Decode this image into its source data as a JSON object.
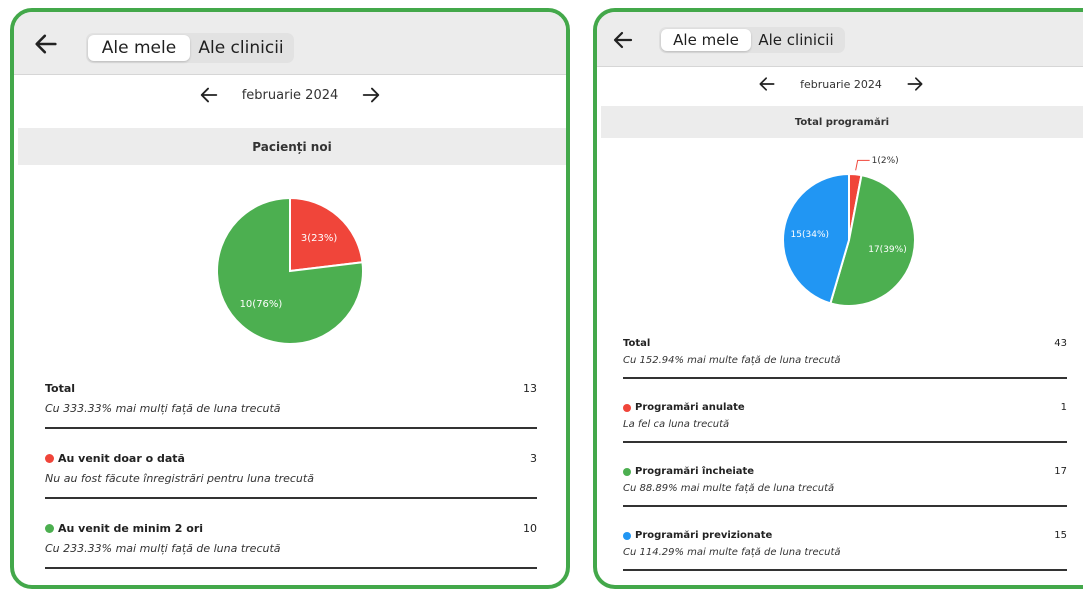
{
  "colors": {
    "frame": "#43a84a",
    "red": "#f0453a",
    "green": "#4caf50",
    "blue": "#2196f3",
    "header_bg": "#ececec"
  },
  "left": {
    "tabs": [
      "Ale mele",
      "Ale clinicii"
    ],
    "active_tab": "Ale mele",
    "month": "februarie 2024",
    "section_title": "Pacienți noi",
    "chart_data": {
      "type": "pie",
      "slices": [
        {
          "label": "3(23%)",
          "value": 3,
          "color": "#f0453a"
        },
        {
          "label": "10(76%)",
          "value": 10,
          "color": "#4caf50"
        }
      ]
    },
    "stats": [
      {
        "title": "Total",
        "value": "13",
        "subtitle": "Cu 333.33% mai mulți față de luna trecută",
        "dot": ""
      },
      {
        "title": "Au venit doar o dată",
        "value": "3",
        "subtitle": "Nu au fost făcute înregistrări pentru luna trecută",
        "dot": "#f0453a"
      },
      {
        "title": "Au venit de minim 2 ori",
        "value": "10",
        "subtitle": "Cu 233.33% mai mulți față de luna trecută",
        "dot": "#4caf50"
      }
    ]
  },
  "right": {
    "tabs": [
      "Ale mele",
      "Ale clinicii"
    ],
    "active_tab": "Ale mele",
    "month": "februarie 2024",
    "section_title": "Total programări",
    "chart_data": {
      "type": "pie",
      "slices": [
        {
          "label": "1(2%)",
          "value": 1,
          "color": "#f0453a"
        },
        {
          "label": "17(39%)",
          "value": 17,
          "color": "#4caf50"
        },
        {
          "label": "15(34%)",
          "value": 15,
          "color": "#2196f3"
        }
      ]
    },
    "stats": [
      {
        "title": "Total",
        "value": "43",
        "subtitle": "Cu 152.94% mai multe față de luna trecută",
        "dot": ""
      },
      {
        "title": "Programări anulate",
        "value": "1",
        "subtitle": "La fel ca luna trecută",
        "dot": "#f0453a"
      },
      {
        "title": "Programări încheiate",
        "value": "17",
        "subtitle": "Cu 88.89% mai multe față de luna trecută",
        "dot": "#4caf50"
      },
      {
        "title": "Programări previzionate",
        "value": "15",
        "subtitle": "Cu 114.29% mai multe față de luna trecută",
        "dot": "#2196f3"
      }
    ]
  }
}
